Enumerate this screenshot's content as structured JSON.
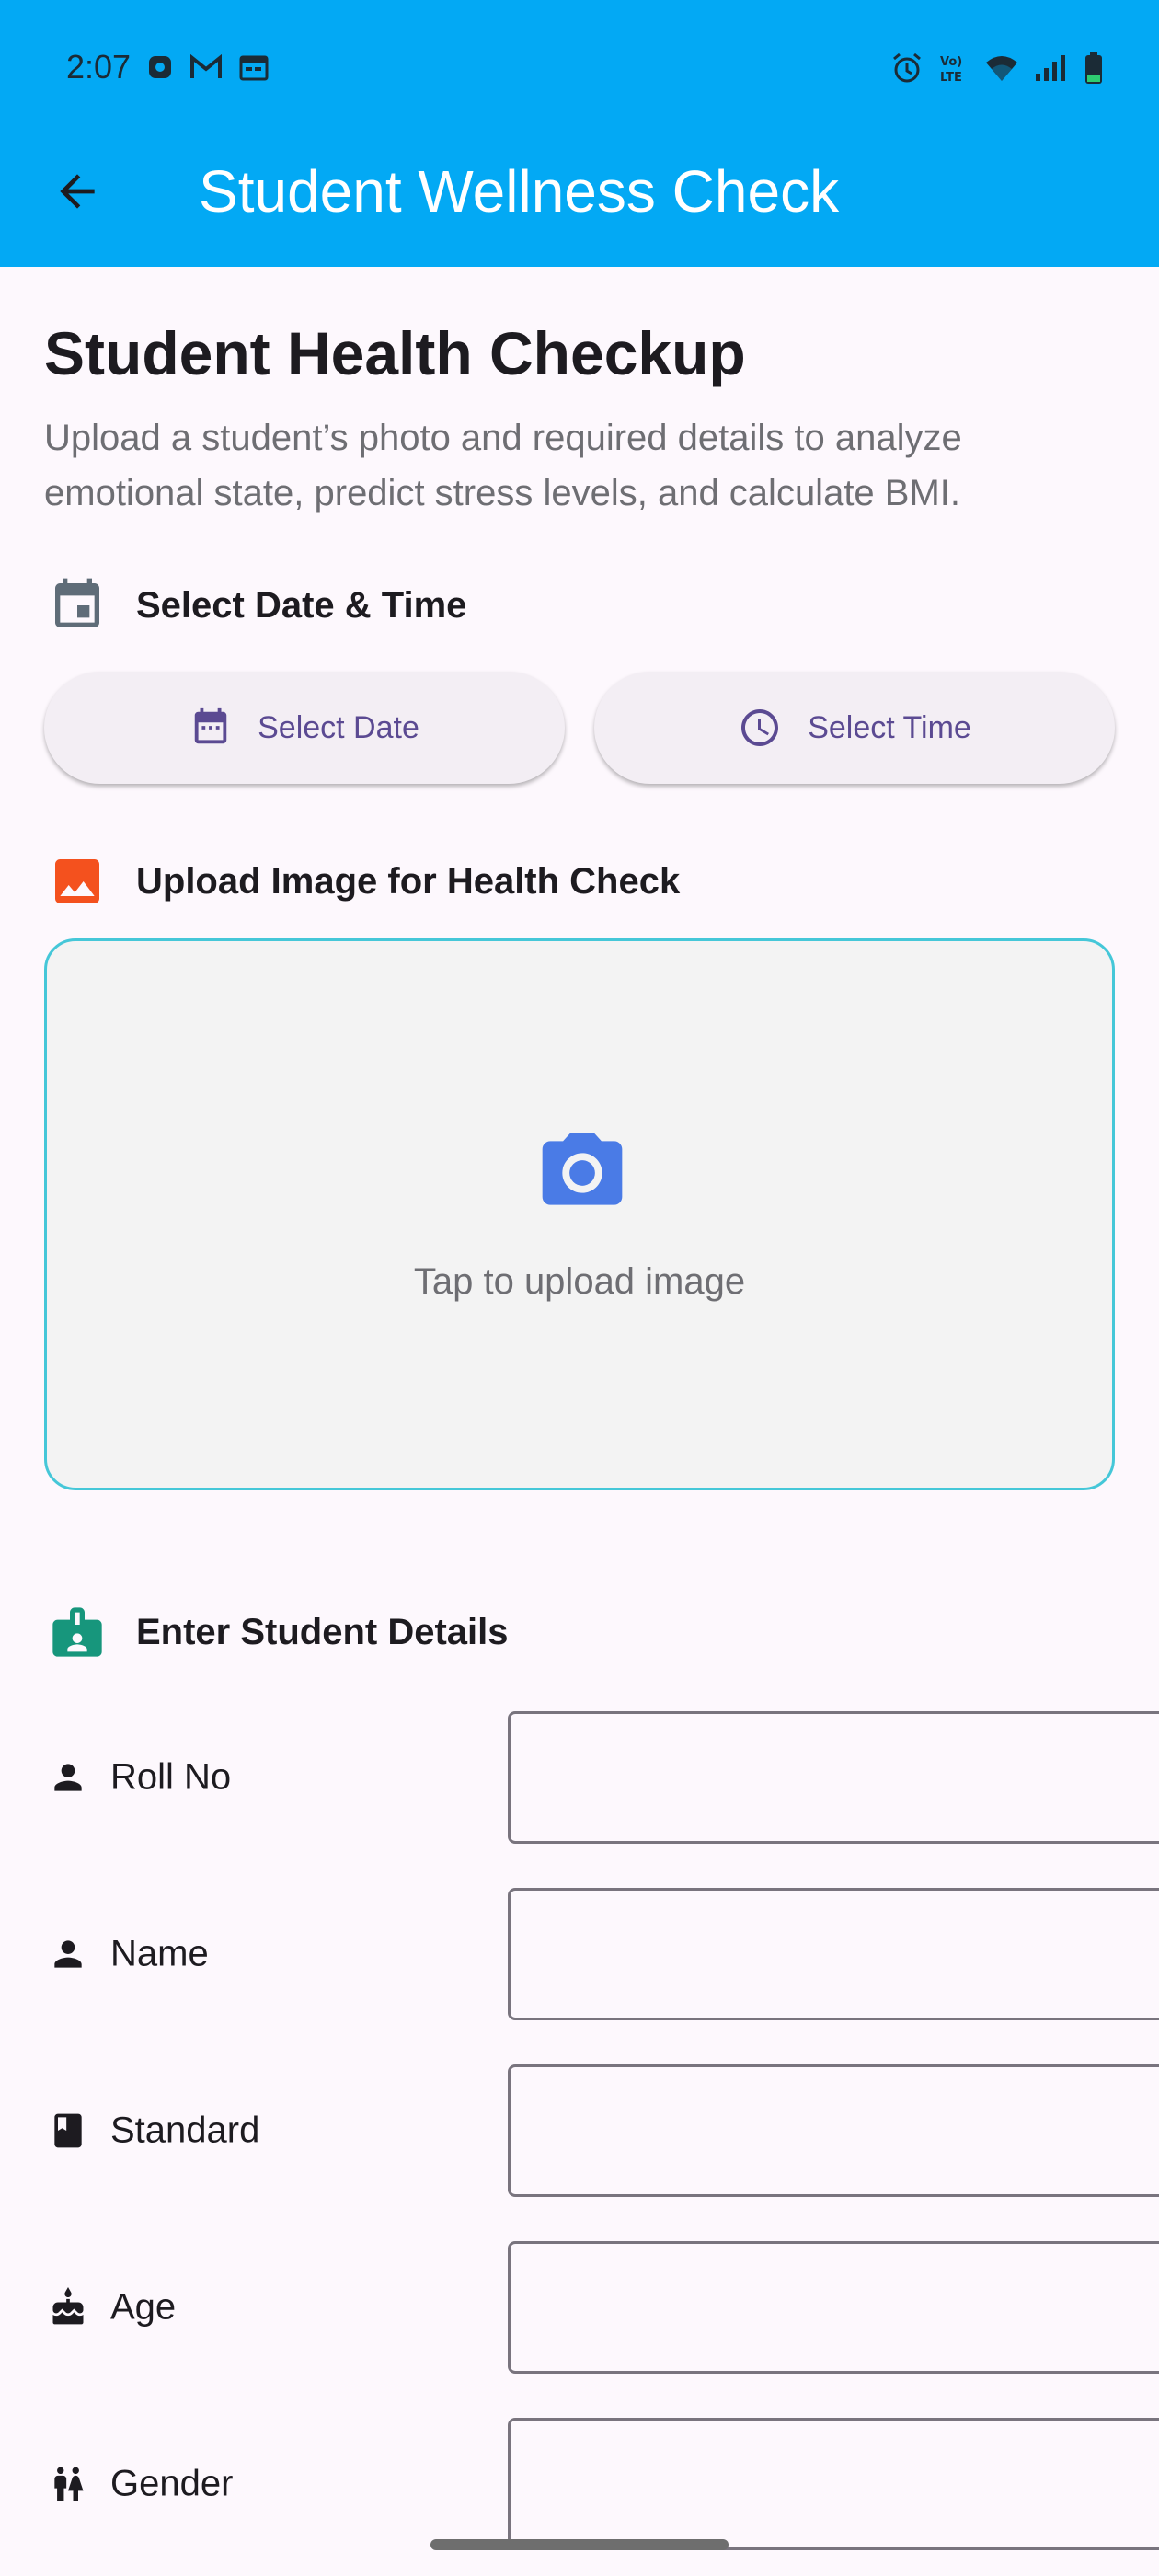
{
  "status_bar": {
    "time": "2:07",
    "left_icons": [
      "app-notification-icon",
      "gmail-icon",
      "calendar-icon"
    ],
    "right_icons": [
      "alarm-icon",
      "volte-icon",
      "wifi-icon",
      "signal-icon",
      "battery-icon"
    ]
  },
  "app_bar": {
    "title": "Student Wellness Check",
    "back_icon": "arrow-back-icon",
    "color": "#03A9F4"
  },
  "header": {
    "title": "Student Health Checkup",
    "description": "Upload a student’s photo and required details to analyze emotional state, predict stress levels, and calculate BMI."
  },
  "date_time_section": {
    "title": "Select Date & Time",
    "icon": "calendar-icon",
    "date_button": "Select Date",
    "time_button": "Select Time"
  },
  "upload_section": {
    "title": "Upload Image for Health Check",
    "icon": "image-icon",
    "prompt": "Tap to upload image",
    "accent": "#45C7D8"
  },
  "details_section": {
    "title": "Enter Student Details",
    "icon": "contact-badge-icon",
    "fields": [
      {
        "label": "Roll No",
        "icon": "person-icon",
        "value": ""
      },
      {
        "label": "Name",
        "icon": "person-icon",
        "value": ""
      },
      {
        "label": "Standard",
        "icon": "book-icon",
        "value": ""
      },
      {
        "label": "Age",
        "icon": "cake-icon",
        "value": ""
      },
      {
        "label": "Gender",
        "icon": "wc-icon",
        "value": ""
      }
    ]
  }
}
